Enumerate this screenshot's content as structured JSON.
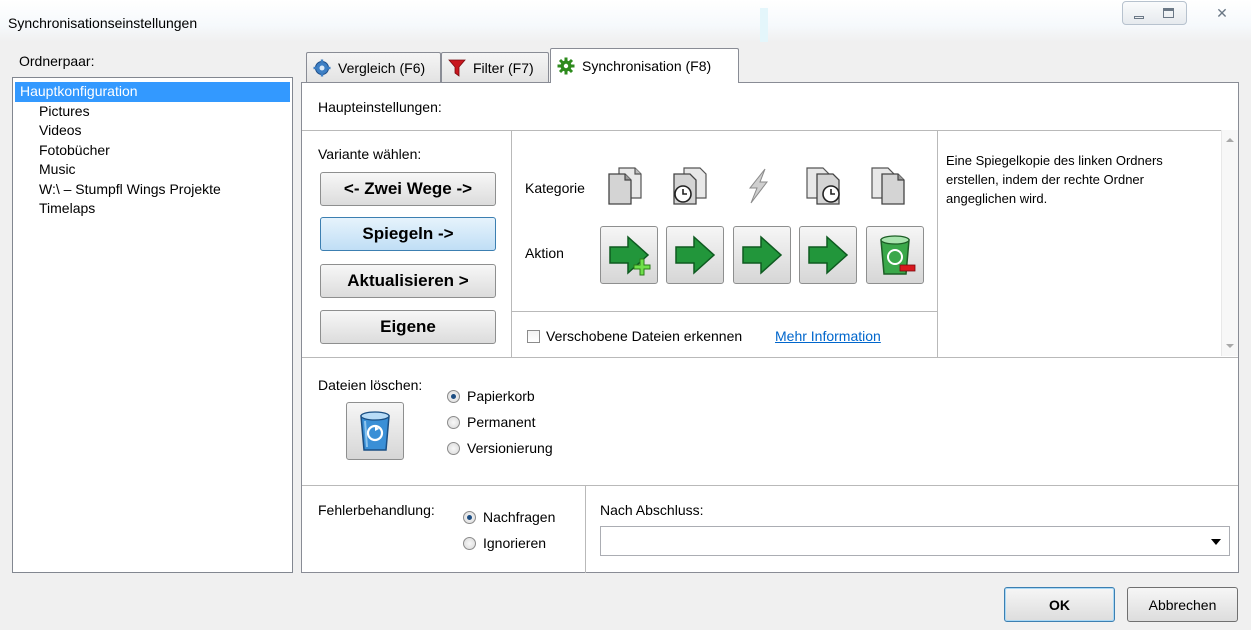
{
  "window": {
    "title": "Synchronisationseinstellungen",
    "close_glyph": "✕"
  },
  "left": {
    "label": "Ordnerpaar:",
    "items": [
      {
        "label": "Hauptkonfiguration",
        "selected": true
      },
      {
        "label": "Pictures"
      },
      {
        "label": "Videos"
      },
      {
        "label": "Fotobücher"
      },
      {
        "label": "Music"
      },
      {
        "label": "W:\\ – Stumpfl Wings Projekte"
      },
      {
        "label": "Timelaps"
      }
    ]
  },
  "tabs": [
    {
      "label": "Vergleich (F6)",
      "icon": "gear-blue-icon"
    },
    {
      "label": "Filter (F7)",
      "icon": "funnel-icon"
    },
    {
      "label": "Synchronisation (F8)",
      "icon": "gear-green-icon",
      "active": true
    }
  ],
  "main": {
    "heading": "Haupteinstellungen:",
    "variant_label": "Variante wählen:",
    "variants": [
      {
        "label": "<- Zwei Wege ->"
      },
      {
        "label": "Spiegeln ->",
        "selected": true
      },
      {
        "label": "Aktualisieren >"
      },
      {
        "label": "Eigene"
      }
    ],
    "category_label": "Kategorie",
    "action_label": "Aktion",
    "category_icons": [
      "file-left-only-icon",
      "file-left-newer-icon",
      "file-different-icon",
      "file-right-newer-icon",
      "file-right-only-icon"
    ],
    "action_icons": [
      "create-right-arrow-icon",
      "update-right-arrow-icon",
      "update-right-arrow-icon",
      "update-right-arrow-icon",
      "delete-right-icon"
    ],
    "description": [
      "Eine Spiegelkopie des linken Ordners",
      "erstellen, indem der rechte Ordner",
      "angeglichen wird."
    ],
    "detect_moved": {
      "label": "Verschobene Dateien erkennen",
      "checked": false
    },
    "more_info": "Mehr Information",
    "delete": {
      "label": "Dateien löschen:",
      "options": [
        {
          "label": "Papierkorb",
          "selected": true
        },
        {
          "label": "Permanent"
        },
        {
          "label": "Versionierung"
        }
      ]
    },
    "error": {
      "label": "Fehlerbehandlung:",
      "options": [
        {
          "label": "Nachfragen",
          "selected": true
        },
        {
          "label": "Ignorieren"
        }
      ]
    },
    "after": {
      "label": "Nach Abschluss:",
      "value": ""
    }
  },
  "buttons": {
    "ok": "OK",
    "cancel": "Abbrechen"
  },
  "colors": {
    "selection": "#3399ff",
    "link": "#0066cc",
    "arrow_green": "#1f9a3a"
  }
}
